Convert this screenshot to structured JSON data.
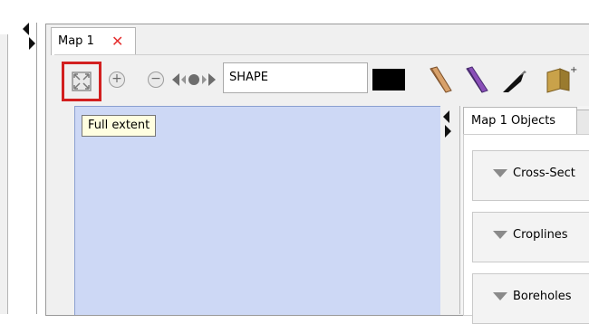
{
  "map_tab": {
    "label": "Map 1",
    "close_icon": "close-icon"
  },
  "toolbar": {
    "full_extent_icon": "full-extent-icon",
    "zoom_in_icon": "zoom-in-icon",
    "zoom_out_icon": "zoom-out-icon",
    "pan_icon": "pan-icon",
    "shape_value": "SHAPE",
    "swatch_color": "#000000",
    "tools": [
      "pen-tool-icon",
      "brush-tool-icon",
      "knife-tool-icon",
      "3d-add-icon"
    ]
  },
  "tooltip": {
    "text": "Full extent"
  },
  "objects_panel": {
    "tab_label": "Map 1 Objects",
    "sections": [
      {
        "label": "Cross-Sect"
      },
      {
        "label": "Croplines"
      },
      {
        "label": "Boreholes"
      }
    ]
  },
  "colors": {
    "canvas": "#cdd8f5",
    "highlight": "#d21f1f",
    "close": "#e53030"
  }
}
